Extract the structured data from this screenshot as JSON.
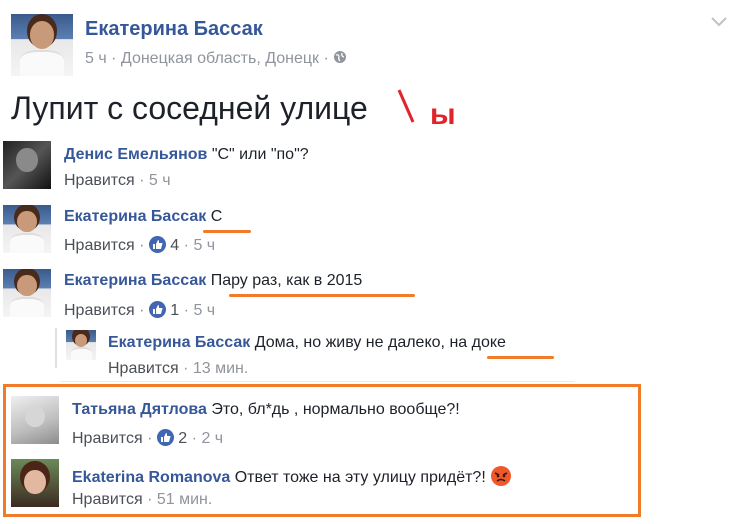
{
  "post": {
    "author": "Екатерина Бассак",
    "time": "5 ч",
    "location": "Донецкая область, Донецк",
    "text": "Лупит с соседней улице",
    "correction": "ы"
  },
  "comments": [
    {
      "name": "Денис Емельянов",
      "text": "\"С\" или \"по\"?",
      "like": "Нравится",
      "sep": "·",
      "time": "5 ч",
      "likes": ""
    },
    {
      "name": "Екатерина Бассак",
      "text": "С",
      "like": "Нравится",
      "sep": "·",
      "time": "5 ч",
      "likes": "4"
    },
    {
      "name": "Екатерина Бассак",
      "text": "Пару раз, как в 2015",
      "like": "Нравится",
      "sep": "·",
      "time": "5 ч",
      "likes": "1"
    },
    {
      "name": "Екатерина Бассак",
      "text": "Дома, но живу не далеко,",
      "text_highlight": "на доке",
      "like": "Нравится",
      "sep": "·",
      "time": "13 мин.",
      "likes": ""
    },
    {
      "name": "Татьяна Дятлова",
      "text": "Это, бл*дь , нормально вообще?!",
      "like": "Нравится",
      "sep": "·",
      "time": "2 ч",
      "likes": "2"
    },
    {
      "name": "Ekaterina Romanova",
      "text": "Ответ тоже на эту улицу придёт?!",
      "like": "Нравится",
      "sep": "·",
      "time": "51 мин.",
      "likes": ""
    }
  ],
  "colors": {
    "link": "#365899",
    "annotation": "#f07c2a",
    "like_blue": "#4267b2",
    "correction_red": "#e0242a"
  },
  "icons": {
    "menu": "chevron-down-icon",
    "privacy": "globe-icon",
    "like": "thumbs-up-icon",
    "reaction": "angry-emoji-icon"
  }
}
